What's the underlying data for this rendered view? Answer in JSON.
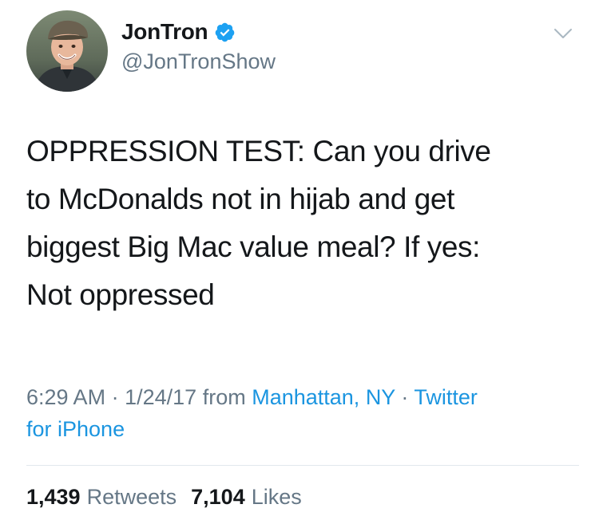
{
  "user": {
    "display_name": "JonTron",
    "handle": "@JonTronShow",
    "verified": true
  },
  "tweet": {
    "text_lines": [
      "OPPRESSION TEST: Can you drive",
      "to McDonalds not in hijab and get",
      "biggest Big Mac value meal? If yes:",
      "Not oppressed"
    ]
  },
  "meta": {
    "time": "6:29 AM",
    "separator": "·",
    "date": "1/24/17",
    "from_label": "from",
    "location": "Manhattan, NY",
    "client_part1": "Twitter",
    "client_part2": "for iPhone"
  },
  "stats": {
    "retweets_count": "1,439",
    "retweets_label": "Retweets",
    "likes_count": "7,104",
    "likes_label": "Likes"
  },
  "colors": {
    "text": "#14171a",
    "secondary": "#657786",
    "link": "#1b95e0",
    "verified": "#1da1f2",
    "divider": "#e1e8ed"
  },
  "icons": {
    "verified": "verified-badge-icon",
    "menu": "chevron-down-icon"
  }
}
